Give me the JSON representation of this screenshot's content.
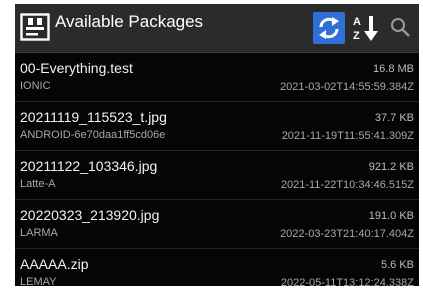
{
  "toolbar": {
    "title": "Available Packages",
    "icons": {
      "app": "package-app-icon",
      "refresh": "refresh-icon",
      "sort": "sort-alpha-down-icon",
      "search": "search-icon"
    }
  },
  "colors": {
    "background": "#050505",
    "toolbar": "#2b2b2b",
    "accent": "#2f6fd6",
    "primary_text": "#f2f2f2",
    "secondary_text": "#a8a8a8"
  },
  "packages": [
    {
      "name": "00-Everything.test",
      "source": "IONIC",
      "size": "16.8 MB",
      "date": "2021-03-02T14:55:59.384Z"
    },
    {
      "name": "20211119_115523_t.jpg",
      "source": "ANDROID-6e70daa1ff5cd06e",
      "size": "37.7 KB",
      "date": "2021-11-19T11:55:41.309Z"
    },
    {
      "name": "20211122_103346.jpg",
      "source": "Latte-A",
      "size": "921.2 KB",
      "date": "2021-11-22T10:34:46.515Z"
    },
    {
      "name": "20220323_213920.jpg",
      "source": "LARMA",
      "size": "191.0 KB",
      "date": "2022-03-23T21:40:17.404Z"
    },
    {
      "name": "AAAAA.zip",
      "source": "LEMAY",
      "size": "5.6 KB",
      "date": "2022-05-11T13:12:24.338Z"
    }
  ]
}
